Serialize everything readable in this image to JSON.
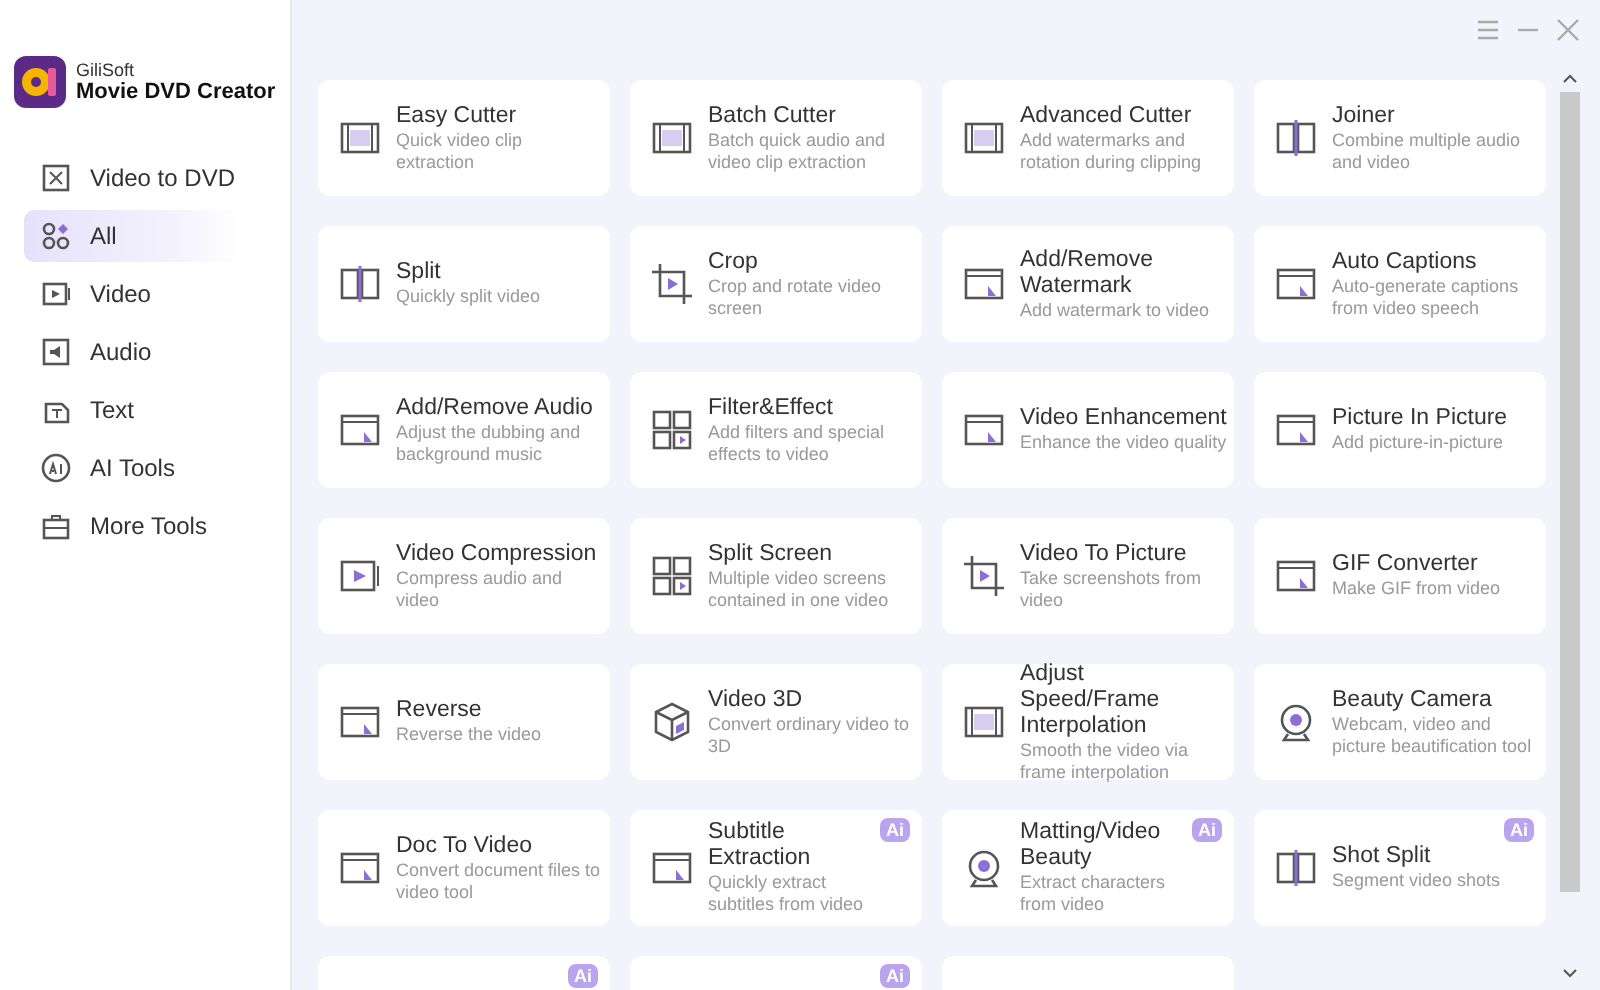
{
  "app": {
    "vendor": "GiliSoft",
    "name": "Movie DVD Creator"
  },
  "sidebar": {
    "items": [
      {
        "label": "Video to DVD",
        "selected": false
      },
      {
        "label": "All",
        "selected": true
      },
      {
        "label": "Video",
        "selected": false
      },
      {
        "label": "Audio",
        "selected": false
      },
      {
        "label": "Text",
        "selected": false
      },
      {
        "label": "AI Tools",
        "selected": false
      },
      {
        "label": "More Tools",
        "selected": false
      }
    ]
  },
  "tools": [
    {
      "kind": "tool",
      "title": "Easy Cutter",
      "description": "Quick video clip extraction"
    },
    {
      "kind": "tool",
      "title": "Batch Cutter",
      "description": "Batch quick audio and video clip extraction"
    },
    {
      "kind": "tool",
      "title": "Advanced Cutter",
      "description": "Add watermarks and rotation during clipping"
    },
    {
      "kind": "tool",
      "title": "Joiner",
      "description": "Combine multiple audio and video"
    },
    {
      "kind": "tool",
      "title": "Split",
      "description": "Quickly split video"
    },
    {
      "kind": "tool",
      "title": "Crop",
      "description": "Crop and rotate video screen"
    },
    {
      "kind": "tool",
      "title": "Add/Remove Watermark",
      "description": "Add watermark to video"
    },
    {
      "kind": "tool",
      "title": "Auto Captions",
      "description": "Auto-generate captions from video speech"
    },
    {
      "kind": "tool",
      "title": "Add/Remove Audio",
      "description": "Adjust the dubbing and background music"
    },
    {
      "kind": "tool",
      "title": "Filter&Effect",
      "description": "Add filters and special effects to video"
    },
    {
      "kind": "tool",
      "title": "Video Enhancement",
      "description": "Enhance the video quality"
    },
    {
      "kind": "tool",
      "title": "Picture In Picture",
      "description": "Add picture-in-picture"
    },
    {
      "kind": "tool",
      "title": "Video Compression",
      "description": "Compress audio and video"
    },
    {
      "kind": "tool",
      "title": "Split Screen",
      "description": "Multiple video screens contained in one video"
    },
    {
      "kind": "tool",
      "title": "Video To Picture",
      "description": "Take screenshots from video"
    },
    {
      "kind": "tool",
      "title": "GIF Converter",
      "description": "Make GIF from video"
    },
    {
      "kind": "tool",
      "title": "Reverse",
      "description": "Reverse the video"
    },
    {
      "kind": "tool",
      "title": "Video 3D",
      "description": "Convert ordinary video to 3D"
    },
    {
      "kind": "tool",
      "title": "Adjust Speed/Frame Interpolation",
      "description": "Smooth the video via frame interpolation"
    },
    {
      "kind": "tool",
      "title": "Beauty Camera",
      "description": "Webcam, video and picture beautification tool"
    },
    {
      "kind": "tool",
      "title": "Doc To Video",
      "description": "Convert document files to video tool"
    },
    {
      "kind": "tool",
      "title": "Subtitle Extraction",
      "description": "Quickly extract subtitles from video",
      "badge": "Ai"
    },
    {
      "kind": "tool",
      "title": "Matting/Video Beauty",
      "description": "Extract characters from video",
      "badge": "Ai"
    },
    {
      "kind": "tool",
      "title": "Shot Split",
      "description": "Segment video shots",
      "badge": "Ai"
    },
    {
      "kind": "partial",
      "badge": "Ai"
    },
    {
      "kind": "partial",
      "badge": "Ai"
    },
    {
      "kind": "partial"
    }
  ]
}
